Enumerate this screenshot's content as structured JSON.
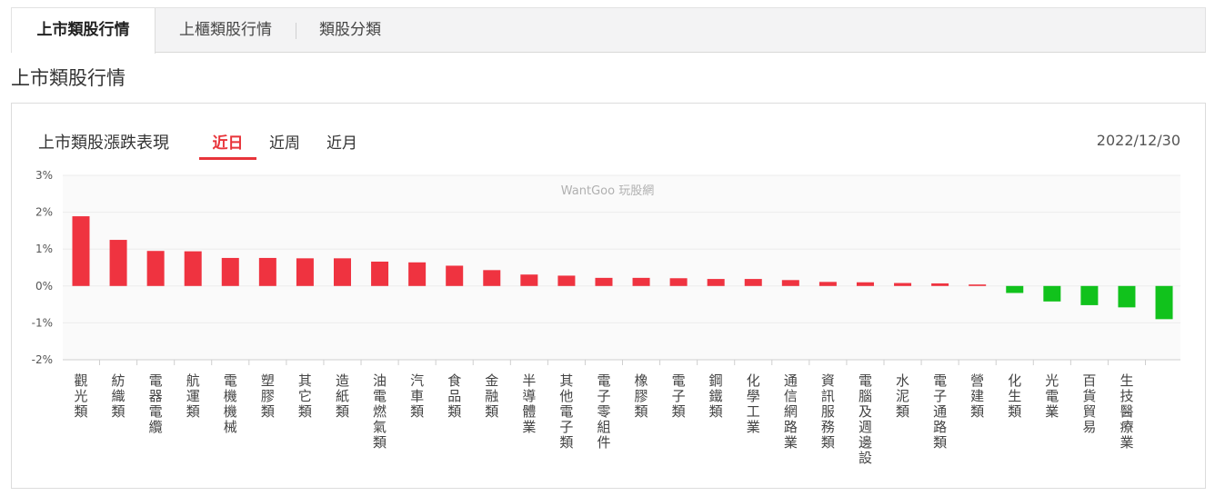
{
  "tabs": [
    {
      "label": "上市類股行情",
      "active": true
    },
    {
      "label": "上櫃類股行情",
      "active": false
    },
    {
      "label": "類股分類",
      "active": false
    }
  ],
  "section_title": "上市類股行情",
  "chart_header": {
    "title": "上市類股漲跌表現",
    "periods": [
      {
        "label": "近日",
        "active": true
      },
      {
        "label": "近周",
        "active": false
      },
      {
        "label": "近月",
        "active": false
      }
    ],
    "date": "2022/12/30"
  },
  "watermark": "WantGoo 玩股網",
  "colors": {
    "up": "#ef3340",
    "down": "#11c21c",
    "accent": "#e8343a"
  },
  "chart_data": {
    "type": "bar",
    "title": "",
    "xlabel": "",
    "ylabel": "",
    "ylim": [
      -2,
      3
    ],
    "yticks": [
      3,
      2,
      1,
      0,
      -1,
      -2
    ],
    "ytick_labels": [
      "3%",
      "2%",
      "1%",
      "0%",
      "-1%",
      "-2%"
    ],
    "grid": true,
    "categories": [
      "觀光類",
      "紡織類",
      "電器電纜",
      "航運類",
      "電機機械",
      "塑膠類",
      "其它類",
      "造紙類",
      "油電燃氣類",
      "汽車類",
      "食品類",
      "金融類",
      "半導體業",
      "其他電子類",
      "電子零組件",
      "橡膠類",
      "電子類",
      "鋼鐵類",
      "化學工業",
      "通信網路業",
      "資訊服務類",
      "電腦及週邊設",
      "水泥類",
      "電子通路類",
      "營建類",
      "化生類",
      "光電業",
      "百貨貿易",
      "生技醫療業"
    ],
    "values": [
      1.89,
      1.25,
      0.95,
      0.94,
      0.76,
      0.76,
      0.75,
      0.75,
      0.66,
      0.64,
      0.55,
      0.43,
      0.31,
      0.28,
      0.22,
      0.22,
      0.21,
      0.19,
      0.19,
      0.16,
      0.11,
      0.1,
      0.08,
      0.07,
      0.04,
      -0.19,
      -0.42,
      -0.52,
      -0.58,
      -0.9
    ]
  }
}
